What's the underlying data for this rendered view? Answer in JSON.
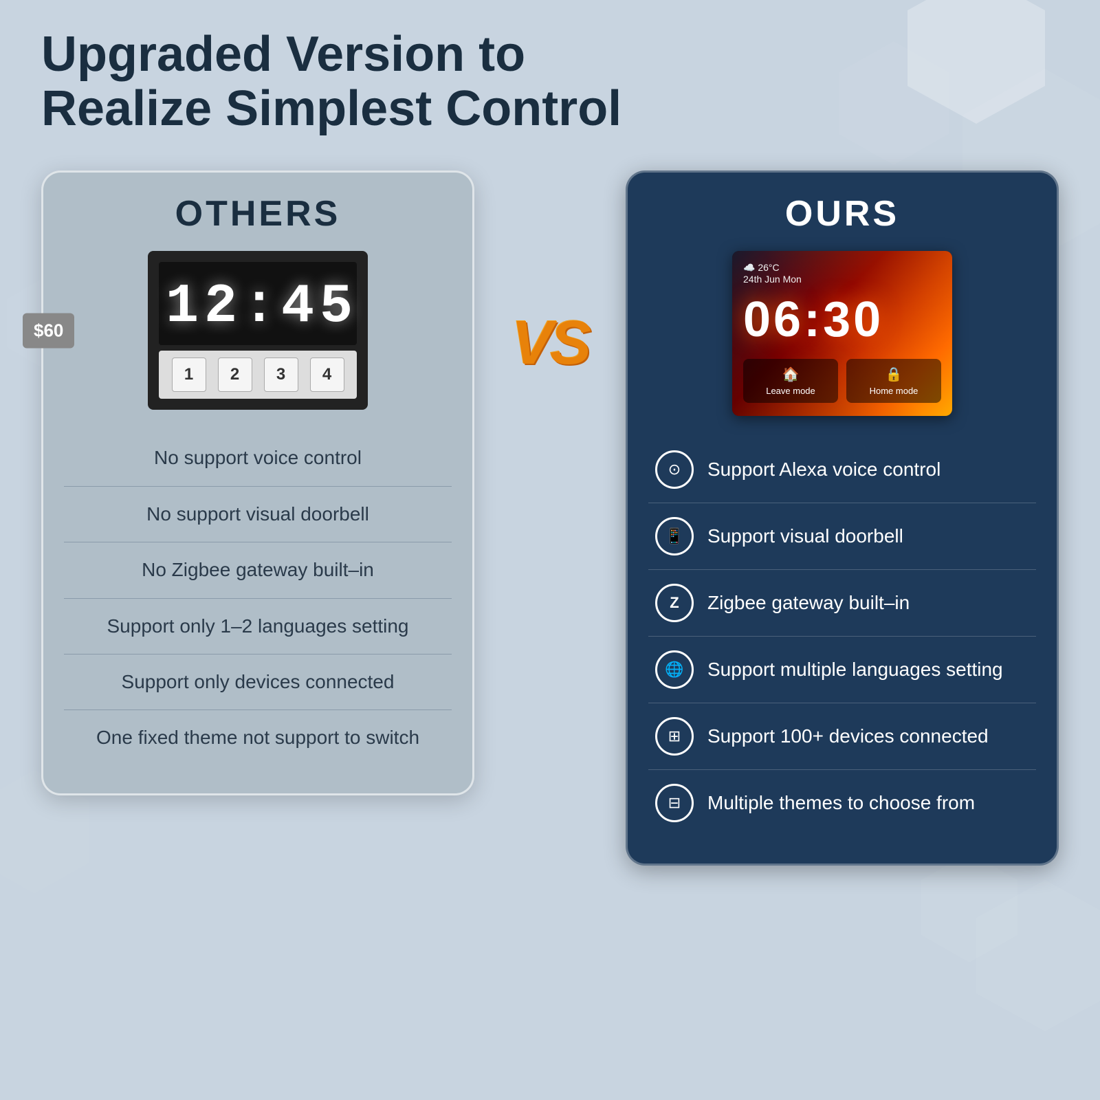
{
  "title": "Upgraded Version to Realize Simplest Control",
  "others": {
    "label": "OTHERS",
    "price": "$60",
    "clock_time": "12:45",
    "buttons": [
      "1",
      "2",
      "3",
      "4"
    ],
    "features": [
      "No support voice control",
      "No support visual doorbell",
      "No Zigbee gateway built–in",
      "Support only 1–2 languages setting",
      "Support only devices connected",
      "One fixed theme not support to switch"
    ]
  },
  "vs_label": "VS",
  "ours": {
    "label": "OURS",
    "weather": "26°C",
    "date": "24th Jun Mon",
    "clock_time": "06:30",
    "modes": [
      {
        "icon": "🏠",
        "label": "Leave mode"
      },
      {
        "icon": "🔒",
        "label": "Home mode"
      }
    ],
    "features": [
      {
        "icon": "⊙",
        "text": "Support Alexa voice control"
      },
      {
        "icon": "📱",
        "text": "Support visual doorbell"
      },
      {
        "icon": "Ⓩ",
        "text": "Zigbee gateway built–in"
      },
      {
        "icon": "🌐",
        "text": "Support multiple languages setting"
      },
      {
        "icon": "⊞",
        "text": "Support 100+ devices connected"
      },
      {
        "icon": "⊟",
        "text": "Multiple themes to choose from"
      }
    ]
  }
}
